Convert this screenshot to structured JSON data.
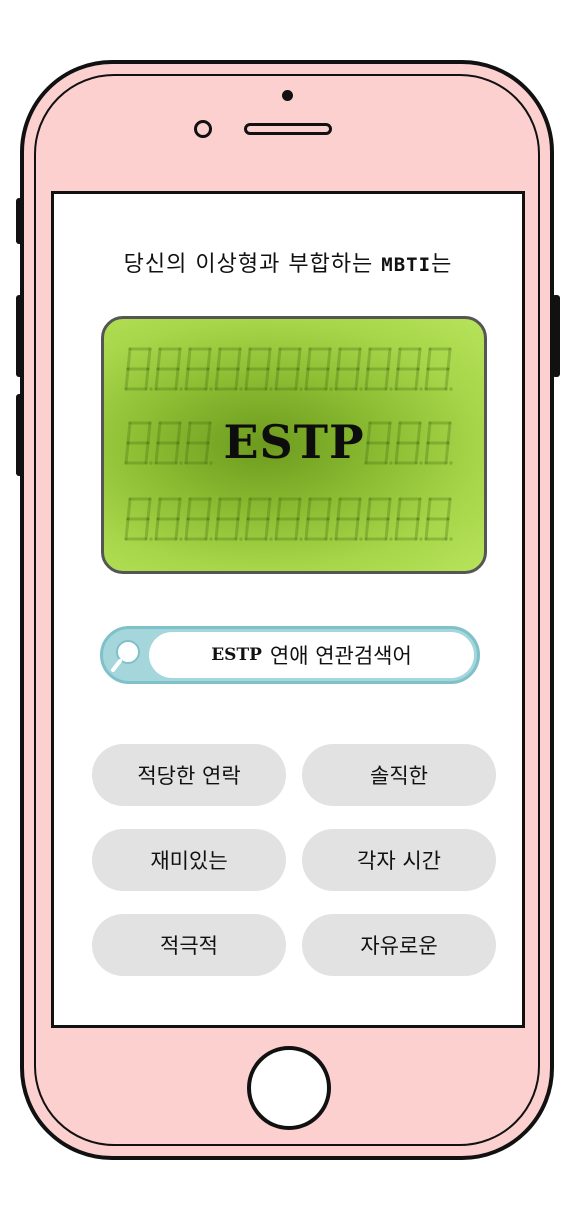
{
  "screen": {
    "headline_prefix": "당신의 이상형과 부합하는 ",
    "headline_mbti": "MBTI",
    "headline_suffix": "는",
    "result_type": "ESTP"
  },
  "search": {
    "query_type": "ESTP",
    "query_text": "연애 연관검색어",
    "icon": "magnifier-icon"
  },
  "tags": [
    {
      "label": "적당한 연락"
    },
    {
      "label": "솔직한"
    },
    {
      "label": "재미있는"
    },
    {
      "label": "각자 시간"
    },
    {
      "label": "적극적"
    },
    {
      "label": "자유로운"
    }
  ],
  "colors": {
    "phone_body": "#fdd0d0",
    "lcd_green": "#a8d64a",
    "search_accent": "#a4d6dc",
    "tag_bg": "#e2e2e2"
  }
}
